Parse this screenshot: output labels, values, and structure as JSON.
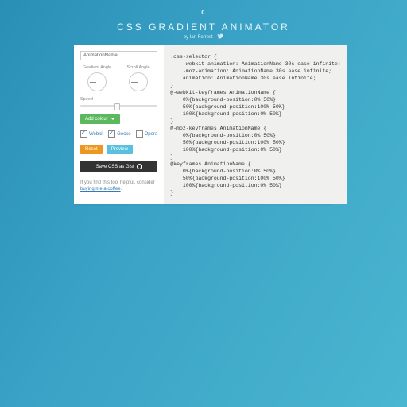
{
  "header": {
    "title": "CSS GRADIENT ANIMATOR",
    "byline": "by Ian Forrest"
  },
  "controls": {
    "animation_name_value": "AnimationName",
    "gradient_angle_label": "Gradient Angle",
    "scroll_angle_label": "Scroll Angle",
    "speed_label": "Speed",
    "add_colour_label": "Add colour",
    "prefixes": {
      "webkit": {
        "label": "Webkit",
        "checked": true
      },
      "gecko": {
        "label": "Gecko",
        "checked": true
      },
      "opera": {
        "label": "Opera",
        "checked": false
      }
    },
    "reset_label": "Reset",
    "preview_label": "Preview",
    "save_gist_label": "Save CSS as Gist"
  },
  "help": {
    "text": "If you find this tool helpful, consider",
    "link": "buying me a coffee"
  },
  "code": ".css-selector {\n    -webkit-animation: AnimationName 30s ease infinite;\n    -moz-animation: AnimationName 30s ease infinite;\n    animation: AnimationName 30s ease infinite;\n}\n@-webkit-keyframes AnimationName {\n    0%{background-position:0% 50%}\n    50%{background-position:100% 50%}\n    100%{background-position:0% 50%}\n}\n@-moz-keyframes AnimationName {\n    0%{background-position:0% 50%}\n    50%{background-position:100% 50%}\n    100%{background-position:0% 50%}\n}\n@keyframes AnimationName {\n    0%{background-position:0% 50%}\n    50%{background-position:100% 50%}\n    100%{background-position:0% 50%}\n}"
}
